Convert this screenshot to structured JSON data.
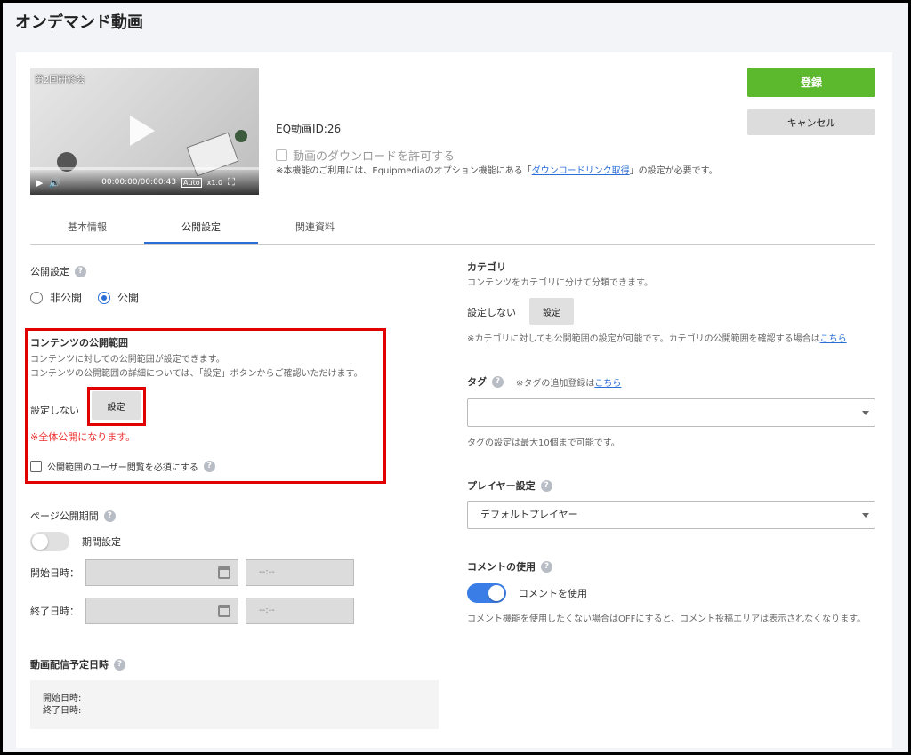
{
  "page": {
    "title": "オンデマンド動画"
  },
  "video": {
    "overlay_label": "第2回研修会",
    "time": "00:00:00/00:00:43",
    "auto_label": "Auto",
    "speed_label": "x1.0"
  },
  "meta": {
    "eq_id": "EQ動画ID:26",
    "download_label": "動画のダウンロードを許可する",
    "download_note_pre": "※本機能のご利用には、Equipmediaのオプション機能にある「",
    "download_note_link": "ダウンロードリンク取得",
    "download_note_post": "」の設定が必要です。"
  },
  "actions": {
    "register": "登録",
    "cancel": "キャンセル"
  },
  "tabs": [
    {
      "label": "基本情報"
    },
    {
      "label": "公開設定"
    },
    {
      "label": "関連資料"
    }
  ],
  "publish": {
    "label": "公開設定",
    "options": [
      {
        "label": "非公開"
      },
      {
        "label": "公開"
      }
    ],
    "selected": "公開"
  },
  "scope": {
    "title": "コンテンツの公開範囲",
    "desc1": "コンテンツに対しての公開範囲が設定できます。",
    "desc2": "コンテンツの公開範囲の詳細については、「設定」ボタンからご確認いただけます。",
    "status": "設定しない",
    "button": "設定",
    "warning": "※全体公開になります。",
    "require_check": "公開範囲のユーザー閲覧を必須にする"
  },
  "period": {
    "label": "ページ公開期間",
    "toggle_label": "期間設定",
    "start_label": "開始日時：",
    "end_label": "終了日時：",
    "time_placeholder": "--:--"
  },
  "schedule": {
    "label": "動画配信予定日時",
    "start": "開始日時:",
    "end": "終了日時:"
  },
  "category": {
    "title": "カテゴリ",
    "desc": "コンテンツをカテゴリに分けて分類できます。",
    "status": "設定しない",
    "button": "設定",
    "note_pre": "※カテゴリに対しても公開範囲の設定が可能です。カテゴリの公開範囲を確認する場合は",
    "note_link": "こちら"
  },
  "tag": {
    "label": "タグ",
    "note_pre": "※タグの追加登録は",
    "note_link": "こちら",
    "value": "",
    "help": "タグの設定は最大10個まで可能です。"
  },
  "player": {
    "label": "プレイヤー設定",
    "value": "デフォルトプレイヤー"
  },
  "comment": {
    "label": "コメントの使用",
    "toggle_label": "コメントを使用",
    "note": "コメント機能を使用したくない場合はOFFにすると、コメント投稿エリアは表示されなくなります。"
  },
  "colors": {
    "accent": "#2b6fd6",
    "primary_button": "#5cb82c",
    "highlight": "#e00000",
    "warning": "#e33333"
  }
}
